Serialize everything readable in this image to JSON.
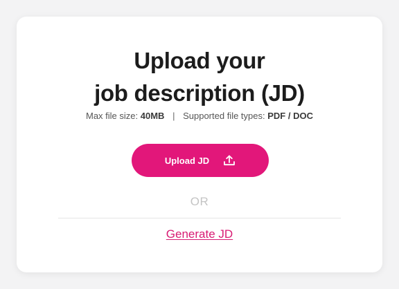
{
  "upload": {
    "title_line1": "Upload your",
    "title_line2": "job description (JD)",
    "max_size_label": "Max file size:",
    "max_size_value": "40MB",
    "separator": "|",
    "types_label": "Supported file types:",
    "types_value": "PDF / DOC",
    "button_label": "Upload JD",
    "button_icon": "upload-icon",
    "or_text": "OR",
    "generate_label": "Generate JD"
  },
  "colors": {
    "accent": "#e2177a",
    "link": "#d81b73",
    "title": "#1c1c1c",
    "muted": "#c4c4c4"
  }
}
